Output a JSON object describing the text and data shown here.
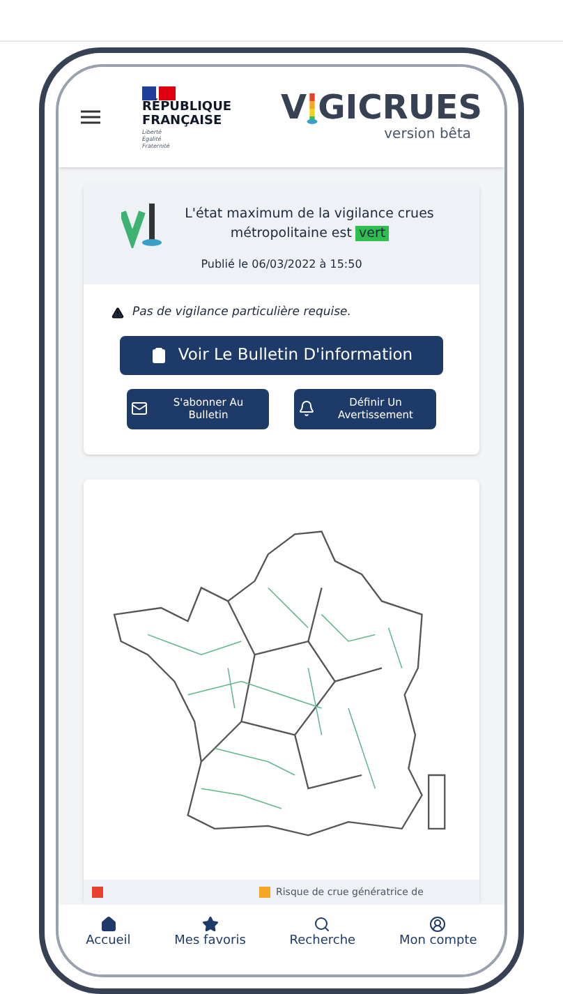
{
  "header": {
    "gov_logo": {
      "lines": [
        "RÉPUBLIQUE",
        "FRANÇAISE"
      ],
      "motto": [
        "Liberté",
        "Égalité",
        "Fraternité"
      ]
    },
    "brand": {
      "name_start": "V",
      "name_end": "GICRUES",
      "subtitle": "version bêta"
    }
  },
  "vigilance_card": {
    "message": "L'état maximum de la vigilance crues métropolitaine est",
    "level_word": "vert",
    "published": "Publié le 06/03/2022 à 15:50",
    "notice": "Pas de vigilance particulière requise.",
    "main_button": "Voir Le Bulletin D'information",
    "buttons": [
      {
        "kind": "mail",
        "label": "S'abonner Au Bulletin"
      },
      {
        "kind": "bell",
        "label": "Définir Un Avertissement"
      }
    ]
  },
  "legend": [
    {
      "color": "#e8412c"
    },
    {
      "color": "#f5a623",
      "label": "Risque de crue génératrice de"
    }
  ],
  "bottom_nav": [
    {
      "kind": "home",
      "label": "Accueil",
      "selected": false
    },
    {
      "kind": "star",
      "label": "Mes favoris",
      "selected": false
    },
    {
      "kind": "search",
      "label": "Recherche",
      "selected": false
    },
    {
      "kind": "account",
      "label": "Mon compte",
      "selected": false
    }
  ]
}
